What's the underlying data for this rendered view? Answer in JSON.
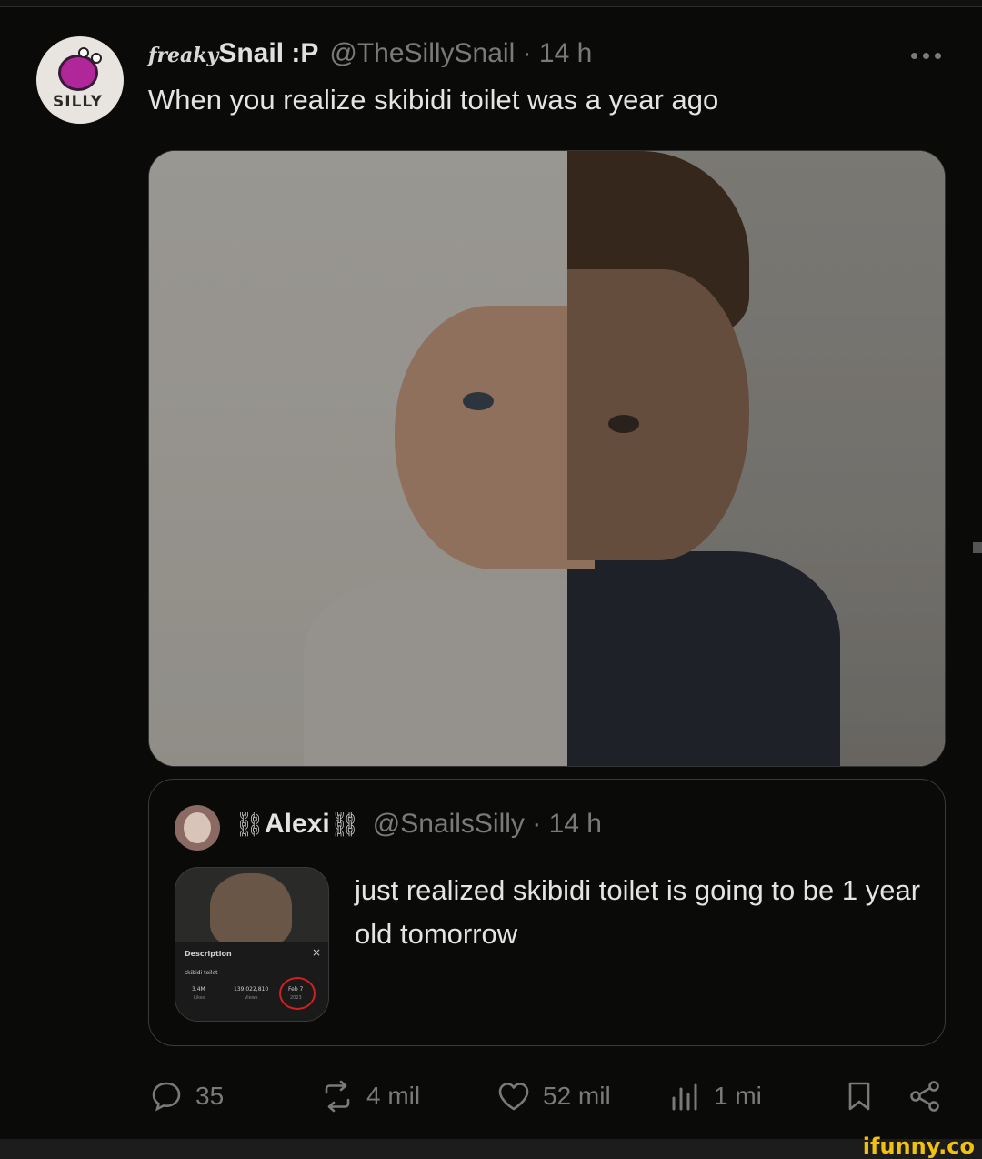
{
  "author": {
    "fancy_prefix": "freaky",
    "name": "Snail :P",
    "handle_time": "@TheSillySnail · 14 h",
    "avatar_text": "SILLY"
  },
  "tweet": {
    "text": "When you realize skibidi toilet was a year ago"
  },
  "quoted": {
    "chain_left": "⛓",
    "name": "Alexi",
    "chain_right": "⛓",
    "handle_time": "@SnailsSilly · 14 h",
    "text": "just realized skibidi toilet is going to be 1 year old tomorrow",
    "thumb": {
      "desc_label": "Description",
      "title": "skibidi toilet",
      "likes": "3.4M",
      "likes_label": "Likes",
      "views": "139,022,810",
      "views_label": "Views",
      "date": "Feb 7",
      "year": "2023",
      "close": "×"
    }
  },
  "actions": {
    "replies": "35",
    "reposts": "4 mil",
    "likes": "52 mil",
    "views": "1 mi"
  },
  "watermark": "ifunny.co",
  "colors": {
    "background": "#0a0a08",
    "muted": "#7a7a7a",
    "text": "#e4e4e4",
    "accent_watermark": "#f2c10e",
    "circle_highlight": "#d02020"
  }
}
